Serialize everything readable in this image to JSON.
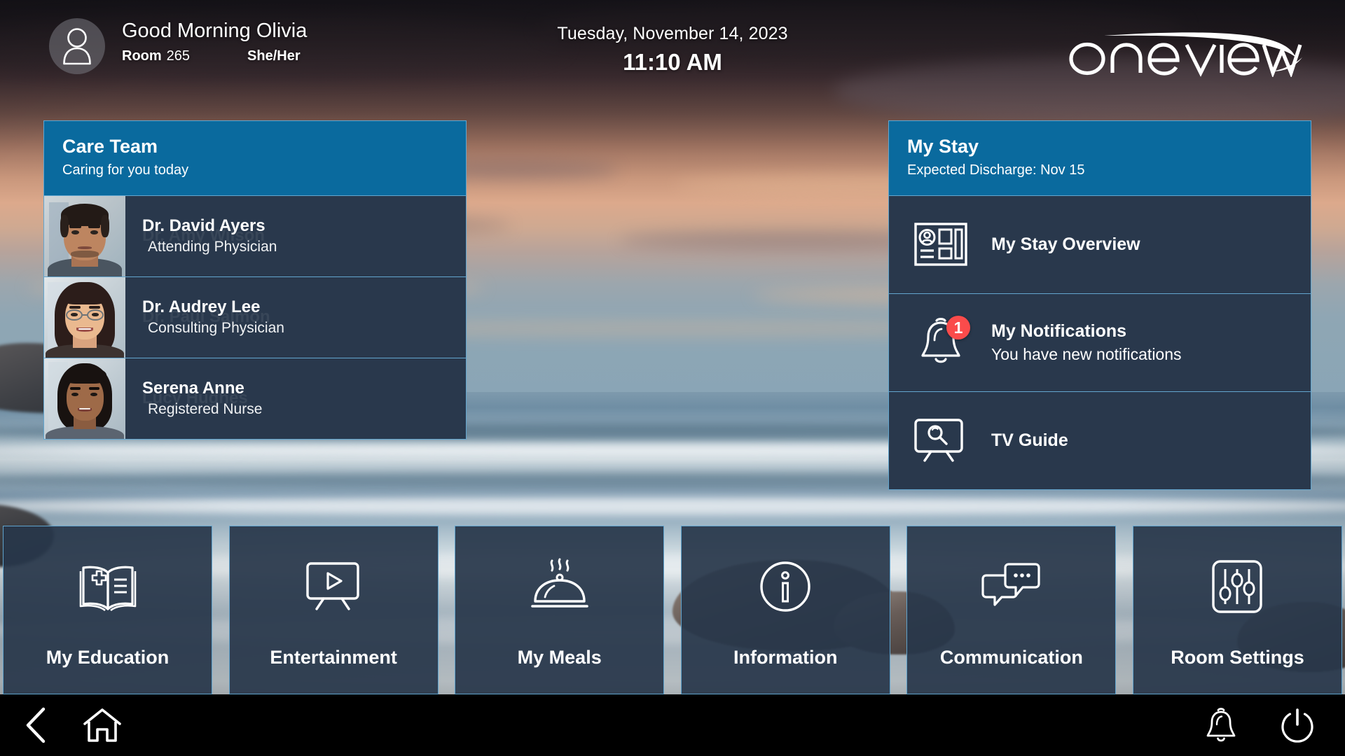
{
  "header": {
    "avatar_icon": "person-icon",
    "greeting": "Good Morning Olivia",
    "room_label": "Room",
    "room_number": "265",
    "pronouns": "She/Her",
    "date": "Tuesday, November 14, 2023",
    "time": "11:10 AM",
    "logo_text": "Oneview"
  },
  "care_team": {
    "title": "Care Team",
    "subtitle": "Caring for you today",
    "members": [
      {
        "name": "Dr. David Ayers",
        "role": "Attending Physician",
        "ghost": "Dr. Amy Wilson"
      },
      {
        "name": "Dr. Audrey Lee",
        "role": "Consulting Physician",
        "ghost": "Dr. Paul Salmon"
      },
      {
        "name": "Serena Anne",
        "role": "Registered Nurse",
        "ghost": "Lucy Hughes"
      }
    ]
  },
  "my_stay": {
    "title": "My Stay",
    "subtitle": "Expected Discharge: Nov 15",
    "rows": [
      {
        "title": "My Stay Overview",
        "subtitle": "",
        "icon": "dashboard-icon",
        "badge": ""
      },
      {
        "title": "My Notifications",
        "subtitle": "You have new notifications",
        "icon": "bell-icon",
        "badge": "1"
      },
      {
        "title": "TV Guide",
        "subtitle": "",
        "icon": "tv-search-icon",
        "badge": ""
      }
    ]
  },
  "tiles": [
    {
      "label": "My Education",
      "icon": "book-medical-icon"
    },
    {
      "label": "Entertainment",
      "icon": "tv-play-icon"
    },
    {
      "label": "My Meals",
      "icon": "food-cloche-icon"
    },
    {
      "label": "Information",
      "icon": "info-circle-icon"
    },
    {
      "label": "Communication",
      "icon": "chat-bubbles-icon"
    },
    {
      "label": "Room Settings",
      "icon": "sliders-icon"
    }
  ],
  "navbar": {
    "left": [
      {
        "name": "back-icon",
        "label": "Back"
      },
      {
        "name": "home-icon",
        "label": "Home"
      }
    ],
    "right": [
      {
        "name": "bell-icon",
        "label": "Notifications"
      },
      {
        "name": "power-icon",
        "label": "Power"
      }
    ]
  },
  "colors": {
    "accent_blue": "#0a6a9e",
    "panel_bg": "#28374a",
    "panel_border": "#63a6cf",
    "badge_red": "#fa4b4b",
    "navbar_bg": "#000000"
  }
}
